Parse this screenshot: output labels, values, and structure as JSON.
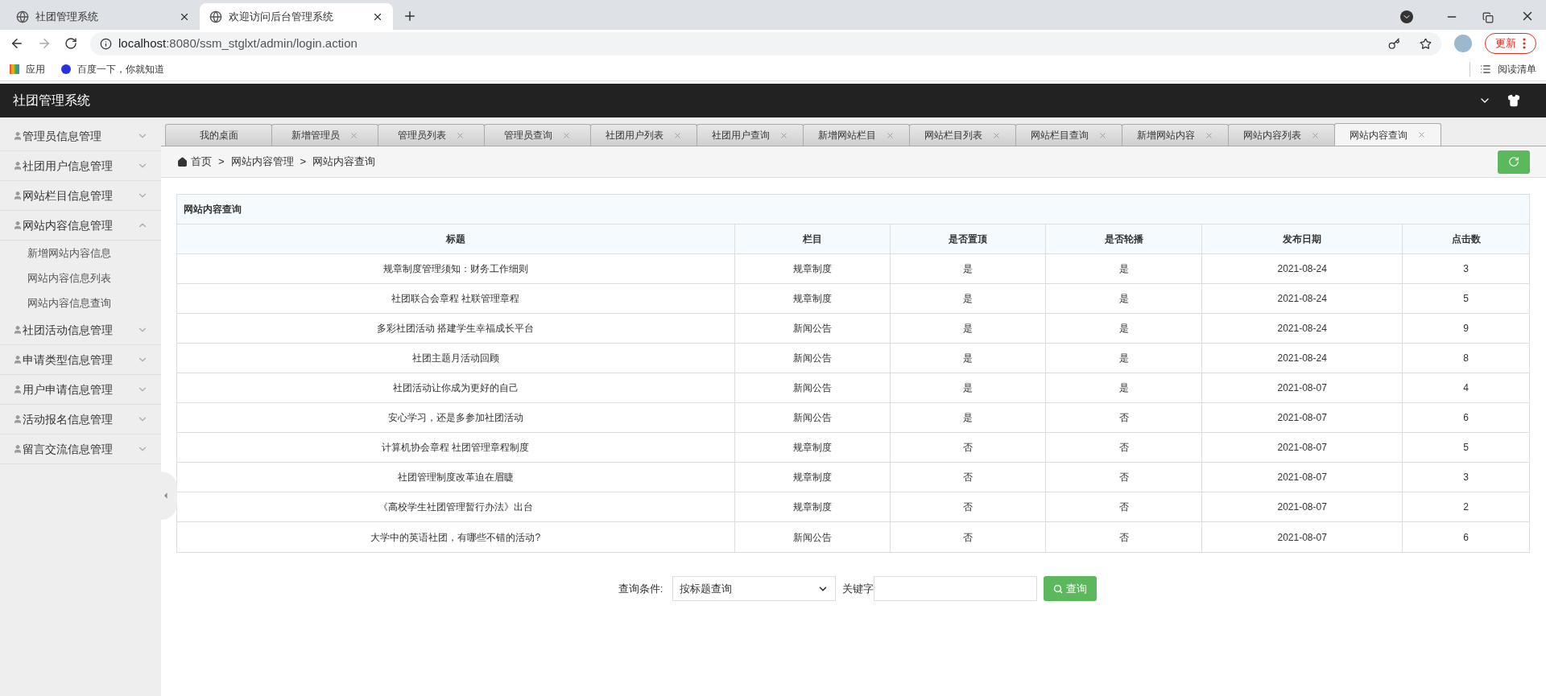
{
  "browser": {
    "tabs": [
      {
        "title": "社团管理系统",
        "selected": false
      },
      {
        "title": "欢迎访问后台管理系统",
        "selected": true
      }
    ],
    "address": {
      "host": "localhost",
      "rest": ":8080/ssm_stglxt/admin/login.action"
    },
    "update_button": "更新",
    "bookmarks": [
      "应用",
      "百度一下，你就知道"
    ],
    "reading_list": "阅读清单"
  },
  "app": {
    "title": "社团管理系统"
  },
  "sidebar": {
    "groups": [
      {
        "label": "管理员信息管理",
        "expanded": false
      },
      {
        "label": "社团用户信息管理",
        "expanded": false
      },
      {
        "label": "网站栏目信息管理",
        "expanded": false
      },
      {
        "label": "网站内容信息管理",
        "expanded": true,
        "children": [
          "新增网站内容信息",
          "网站内容信息列表",
          "网站内容信息查询"
        ]
      },
      {
        "label": "社团活动信息管理",
        "expanded": false
      },
      {
        "label": "申请类型信息管理",
        "expanded": false
      },
      {
        "label": "用户申请信息管理",
        "expanded": false
      },
      {
        "label": "活动报名信息管理",
        "expanded": false
      },
      {
        "label": "留言交流信息管理",
        "expanded": false
      }
    ]
  },
  "page_tabs": [
    {
      "label": "我的桌面",
      "selected": false,
      "closable": false
    },
    {
      "label": "新增管理员",
      "selected": false,
      "closable": true
    },
    {
      "label": "管理员列表",
      "selected": false,
      "closable": true
    },
    {
      "label": "管理员查询",
      "selected": false,
      "closable": true
    },
    {
      "label": "社团用户列表",
      "selected": false,
      "closable": true
    },
    {
      "label": "社团用户查询",
      "selected": false,
      "closable": true
    },
    {
      "label": "新增网站栏目",
      "selected": false,
      "closable": true
    },
    {
      "label": "网站栏目列表",
      "selected": false,
      "closable": true
    },
    {
      "label": "网站栏目查询",
      "selected": false,
      "closable": true
    },
    {
      "label": "新增网站内容",
      "selected": false,
      "closable": true
    },
    {
      "label": "网站内容列表",
      "selected": false,
      "closable": true
    },
    {
      "label": "网站内容查询",
      "selected": true,
      "closable": true
    }
  ],
  "breadcrumb": [
    "首页",
    "网站内容管理",
    "网站内容查询"
  ],
  "breadcrumb_separator": ">",
  "table": {
    "title": "网站内容查询",
    "columns": [
      "标题",
      "栏目",
      "是否置顶",
      "是否轮播",
      "发布日期",
      "点击数"
    ],
    "rows": [
      [
        "规章制度管理须知：财务工作细则",
        "规章制度",
        "是",
        "是",
        "2021-08-24",
        "3"
      ],
      [
        "社团联合会章程 社联管理章程",
        "规章制度",
        "是",
        "是",
        "2021-08-24",
        "5"
      ],
      [
        "多彩社团活动 搭建学生幸福成长平台",
        "新闻公告",
        "是",
        "是",
        "2021-08-24",
        "9"
      ],
      [
        "社团主题月活动回顾",
        "新闻公告",
        "是",
        "是",
        "2021-08-24",
        "8"
      ],
      [
        "社团活动让你成为更好的自己",
        "新闻公告",
        "是",
        "是",
        "2021-08-07",
        "4"
      ],
      [
        "安心学习，还是多参加社团活动",
        "新闻公告",
        "是",
        "否",
        "2021-08-07",
        "6"
      ],
      [
        "计算机协会章程 社团管理章程制度",
        "规章制度",
        "否",
        "否",
        "2021-08-07",
        "5"
      ],
      [
        "社团管理制度改革迫在眉睫",
        "规章制度",
        "否",
        "否",
        "2021-08-07",
        "3"
      ],
      [
        "《高校学生社团管理暂行办法》出台",
        "规章制度",
        "否",
        "否",
        "2021-08-07",
        "2"
      ],
      [
        "大学中的英语社团，有哪些不错的活动?",
        "新闻公告",
        "否",
        "否",
        "2021-08-07",
        "6"
      ]
    ]
  },
  "search": {
    "condition_label": "查询条件:",
    "condition_value": "按标题查询",
    "keyword_label": "关键字",
    "button": "查询"
  }
}
